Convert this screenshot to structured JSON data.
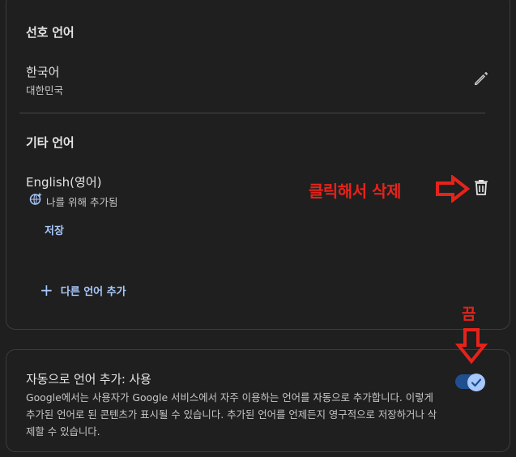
{
  "preferred": {
    "title": "선호 언어",
    "language_name": "한국어",
    "language_region": "대한민국",
    "edit_icon": "pencil-icon"
  },
  "other": {
    "title": "기타 언어",
    "language_name": "English(영어)",
    "added_note": "나를 위해 추가됨",
    "added_icon": "globe-sparkle-icon",
    "save_label": "저장",
    "add_language_label": "다른 언어 추가",
    "delete_icon": "trash-icon"
  },
  "auto_add": {
    "title": "자동으로 언어 추가: 사용",
    "description": "Google에서는 사용자가 Google 서비스에서 자주 이용하는 언어를 자동으로 추가합니다. 이렇게 추가된 언어로 된 콘텐츠가 표시될 수 있습니다. 추가된 언어를 언제든지 영구적으로 저장하거나 삭제할 수 있습니다.",
    "toggle_on": true
  },
  "annotations": {
    "delete_hint": "클릭해서 삭제",
    "toggle_hint": "끔",
    "color": "#e5231b"
  },
  "colors": {
    "background": "#1f1f1f",
    "accent": "#a8c7fa",
    "text_primary": "#e3e3e3",
    "text_secondary": "#c4c7c5"
  }
}
